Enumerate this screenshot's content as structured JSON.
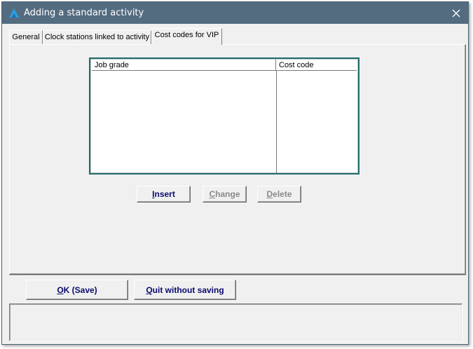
{
  "window": {
    "title": "Adding a standard activity",
    "titlebar_color": "#546c80"
  },
  "tabs": [
    {
      "label": "General",
      "active": false
    },
    {
      "label": "Clock stations linked to activity",
      "active": false
    },
    {
      "label": "Cost codes for VIP",
      "active": true
    }
  ],
  "grid": {
    "columns": [
      "Job grade",
      "Cost code"
    ],
    "rows": [],
    "border_color": "#1c6e6e"
  },
  "grid_buttons": {
    "insert": {
      "label_underlined": "I",
      "label_rest": "nsert",
      "enabled": true
    },
    "change": {
      "label_underlined": "C",
      "label_rest": "hange",
      "enabled": false
    },
    "delete": {
      "label_underlined": "D",
      "label_rest": "elete",
      "enabled": false
    }
  },
  "footer_buttons": {
    "ok": {
      "label_underlined": "O",
      "label_rest": "K (Save)"
    },
    "quit": {
      "label_underlined": "Q",
      "label_rest": "uit without saving"
    }
  },
  "status": {
    "text": ""
  },
  "colors": {
    "enabled_text": "#0a0a6e",
    "disabled_text": "#8a8a8a"
  }
}
